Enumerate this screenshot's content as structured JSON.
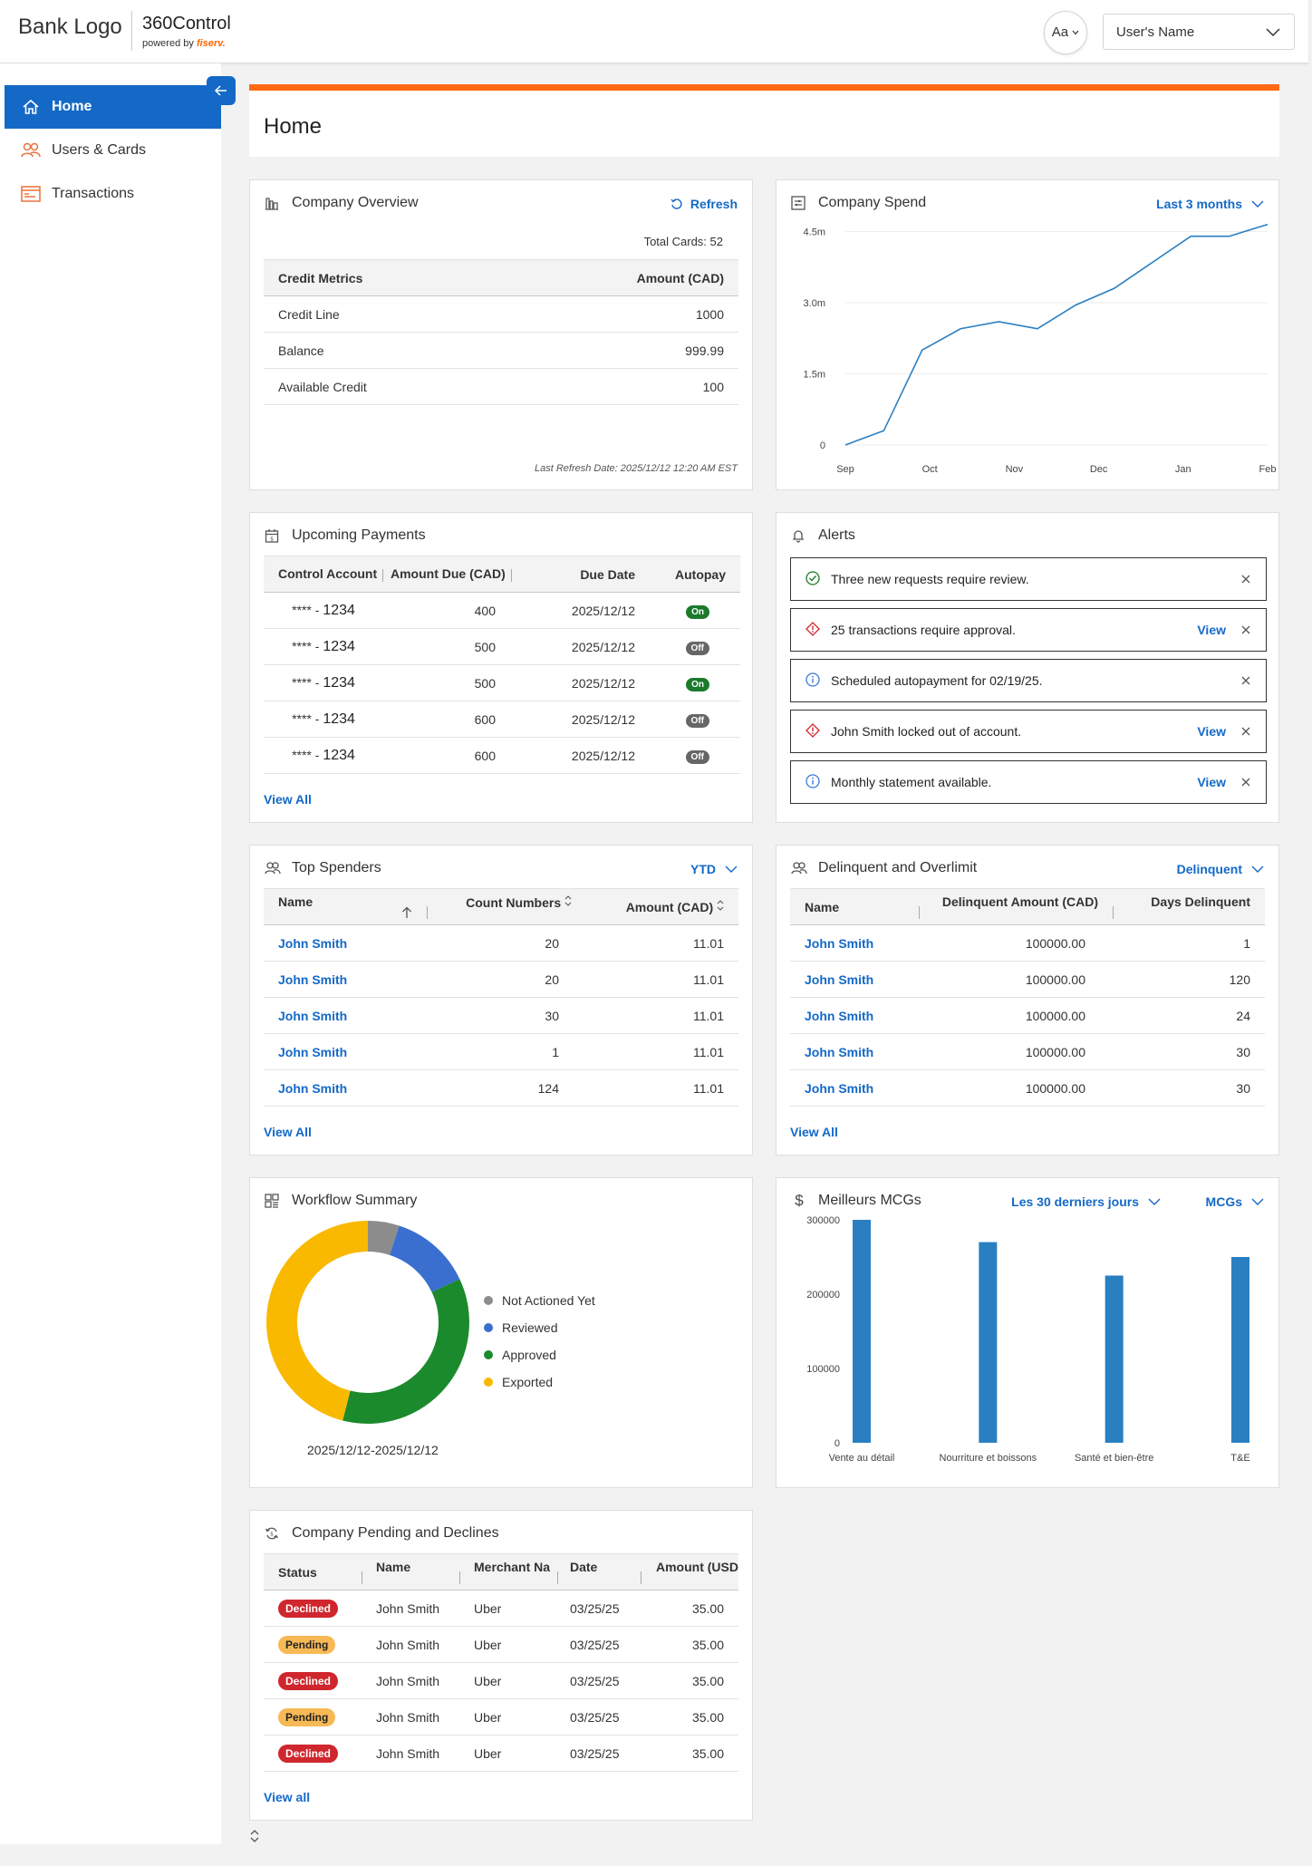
{
  "header": {
    "bank_logo": "Bank Logo",
    "product_name": "360Control",
    "powered_by": "powered by",
    "powered_by_brand": "fiserv.",
    "font_button": "Aa",
    "user_name": "User's Name"
  },
  "sidebar": {
    "items": [
      {
        "label": "Home",
        "icon": "home-icon"
      },
      {
        "label": "Users & Cards",
        "icon": "users-icon"
      },
      {
        "label": "Transactions",
        "icon": "transactions-icon"
      }
    ]
  },
  "page": {
    "title": "Home"
  },
  "company_overview": {
    "title": "Company Overview",
    "refresh_label": "Refresh",
    "total_cards": "Total Cards: 52",
    "columns": [
      "Credit Metrics",
      "Amount (CAD)"
    ],
    "rows": [
      [
        "Credit Line",
        "1000"
      ],
      [
        "Balance",
        "999.99"
      ],
      [
        "Available Credit",
        "100"
      ]
    ],
    "last_refresh": "Last Refresh Date: 2025/12/12 12:20 AM EST"
  },
  "company_spend": {
    "title": "Company Spend",
    "range_label": "Last 3 months"
  },
  "upcoming_payments": {
    "title": "Upcoming Payments",
    "columns": [
      "Control Account",
      "Amount Due (CAD)",
      "Due Date",
      "Autopay"
    ],
    "rows": [
      {
        "account_mask": "****",
        "account": "1234",
        "amount": "400",
        "date": "2025/12/12",
        "autopay": "On"
      },
      {
        "account_mask": "****",
        "account": "1234",
        "amount": "500",
        "date": "2025/12/12",
        "autopay": "Off"
      },
      {
        "account_mask": "****",
        "account": "1234",
        "amount": "500",
        "date": "2025/12/12",
        "autopay": "On"
      },
      {
        "account_mask": "****",
        "account": "1234",
        "amount": "600",
        "date": "2025/12/12",
        "autopay": "Off"
      },
      {
        "account_mask": "****",
        "account": "1234",
        "amount": "600",
        "date": "2025/12/12",
        "autopay": "Off"
      }
    ],
    "view_all": "View All"
  },
  "alerts": {
    "title": "Alerts",
    "items": [
      {
        "text": "Three new requests require review.",
        "type": "success",
        "view": ""
      },
      {
        "text": "25 transactions require approval.",
        "type": "error",
        "view": "View"
      },
      {
        "text": "Scheduled autopayment for 02/19/25.",
        "type": "info",
        "view": ""
      },
      {
        "text": "John Smith locked out of account.",
        "type": "error",
        "view": "View"
      },
      {
        "text": "Monthly statement available.",
        "type": "info",
        "view": "View"
      }
    ]
  },
  "top_spenders": {
    "title": "Top Spenders",
    "period_label": "YTD",
    "columns": [
      "Name",
      "Count Numbers",
      "Amount (CAD)"
    ],
    "rows": [
      [
        "John Smith",
        "20",
        "11.01"
      ],
      [
        "John Smith",
        "20",
        "11.01"
      ],
      [
        "John Smith",
        "30",
        "11.01"
      ],
      [
        "John Smith",
        "1",
        "11.01"
      ],
      [
        "John Smith",
        "124",
        "11.01"
      ]
    ],
    "view_all": "View All"
  },
  "delinquent": {
    "title": "Delinquent and Overlimit",
    "filter_label": "Delinquent",
    "columns": [
      "Name",
      "Delinquent Amount (CAD)",
      "Days Delinquent"
    ],
    "rows": [
      [
        "John Smith",
        "100000.00",
        "1"
      ],
      [
        "John Smith",
        "100000.00",
        "120"
      ],
      [
        "John Smith",
        "100000.00",
        "24"
      ],
      [
        "John Smith",
        "100000.00",
        "30"
      ],
      [
        "John Smith",
        "100000.00",
        "30"
      ]
    ],
    "view_all": "View All"
  },
  "workflow_summary": {
    "title": "Workflow Summary",
    "date_range": "2025/12/12-2025/12/12"
  },
  "top_mcgs": {
    "title": "Meilleurs MCGs",
    "period_label": "Les 30 derniers jours",
    "group_label": "MCGs"
  },
  "pending_declines": {
    "title": "Company Pending and Declines",
    "columns": [
      "Status",
      "Name",
      "Merchant Na",
      "Date",
      "Amount (USD"
    ],
    "rows": [
      {
        "status": "Declined",
        "name": "John Smith",
        "merchant": "Uber",
        "date": "03/25/25",
        "amount": "35.00"
      },
      {
        "status": "Pending",
        "name": "John Smith",
        "merchant": "Uber",
        "date": "03/25/25",
        "amount": "35.00"
      },
      {
        "status": "Declined",
        "name": "John Smith",
        "merchant": "Uber",
        "date": "03/25/25",
        "amount": "35.00"
      },
      {
        "status": "Pending",
        "name": "John Smith",
        "merchant": "Uber",
        "date": "03/25/25",
        "amount": "35.00"
      },
      {
        "status": "Declined",
        "name": "John Smith",
        "merchant": "Uber",
        "date": "03/25/25",
        "amount": "35.00"
      }
    ],
    "view_all": "View all"
  },
  "colors": {
    "primary": "#1469c7",
    "accent": "#ff6a13",
    "success": "#1b7a2b",
    "error": "#d0262d",
    "pending": "#f7b955",
    "bar": "#2a7fc1"
  },
  "chart_data": [
    {
      "type": "line",
      "x": [
        "Sep",
        "",
        "Oct",
        "",
        "Nov",
        "",
        "Dec",
        "",
        "Jan",
        "",
        "Feb",
        ""
      ],
      "x_tick_labels": [
        "Sep",
        "Oct",
        "Nov",
        "Dec",
        "Jan",
        "Feb"
      ],
      "values": [
        0,
        0.3,
        2.0,
        2.45,
        2.6,
        2.45,
        2.95,
        3.3,
        3.85,
        4.4,
        4.4,
        4.65
      ],
      "y_tick_labels": [
        "0",
        "1.5m",
        "3.0m",
        "4.5m"
      ],
      "y_ticks": [
        0,
        1.5,
        3.0,
        4.5
      ],
      "ylim": [
        0,
        4.7
      ],
      "grid": true,
      "color": "#2a7fc1"
    },
    {
      "type": "pie",
      "series": [
        {
          "name": "Not Actioned Yet",
          "value": 5,
          "color": "#8c8c8c"
        },
        {
          "name": "Reviewed",
          "value": 13,
          "color": "#3a6fd0"
        },
        {
          "name": "Approved",
          "value": 36,
          "color": "#1b8a2c"
        },
        {
          "name": "Exported",
          "value": 46,
          "color": "#f9b900"
        }
      ],
      "legend": "right"
    },
    {
      "type": "bar",
      "categories": [
        "Vente au détail",
        "Nourriture et boissons",
        "Santé et bien-être",
        "T&E"
      ],
      "values": [
        300000,
        270000,
        225000,
        250000
      ],
      "y_ticks": [
        0,
        100000,
        200000,
        300000
      ],
      "ylim": [
        0,
        300000
      ],
      "color": "#2a7fc1"
    }
  ]
}
